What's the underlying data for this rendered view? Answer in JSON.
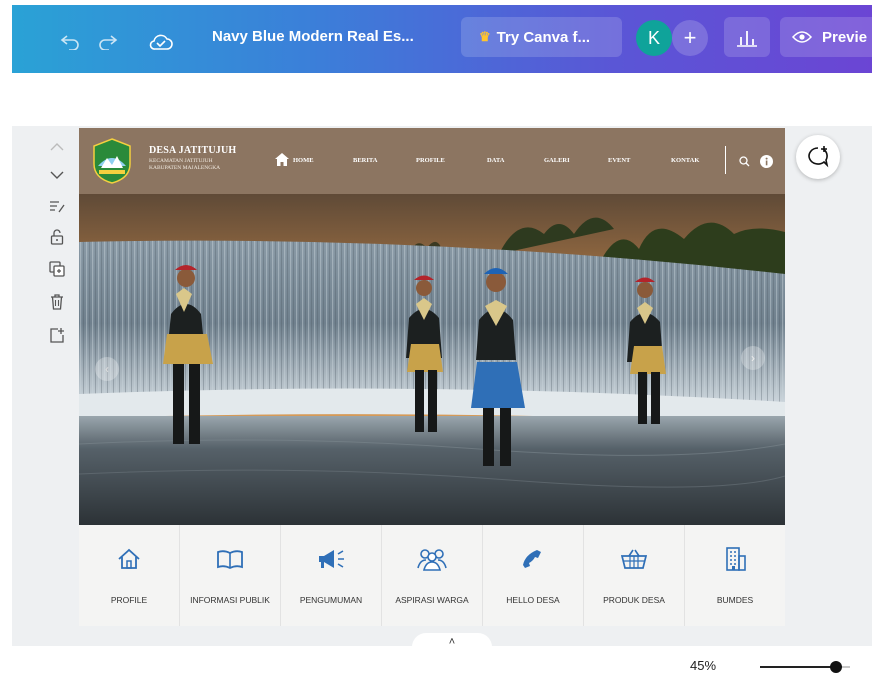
{
  "editor": {
    "doc_title": "Navy Blue Modern Real Es...",
    "try_label": "Try Canva f...",
    "avatar_initial": "K",
    "preview_label": "Previe",
    "zoom": "45%",
    "zoom_fraction": 0.45,
    "accent_start": "#2aa2d6",
    "accent_end": "#6b45d4"
  },
  "site": {
    "name": "DESA JATITUJUH",
    "subtitle": "KECAMATAN JATITUJUH KABUPATEN MAJALENGKA",
    "nav": [
      "HOME",
      "BERITA",
      "PROFILE",
      "DATA",
      "GALERI",
      "EVENT",
      "KONTAK"
    ],
    "header_color": "#8c7561"
  },
  "menu": [
    {
      "label": "PROFILE",
      "icon": "home-outline-icon"
    },
    {
      "label": "INFORMASI PUBLIK",
      "icon": "book-icon"
    },
    {
      "label": "PENGUMUMAN",
      "icon": "megaphone-icon"
    },
    {
      "label": "ASPIRASI WARGA",
      "icon": "users-icon"
    },
    {
      "label": "HELLO DESA",
      "icon": "phone-icon"
    },
    {
      "label": "PRODUK DESA",
      "icon": "basket-icon"
    },
    {
      "label": "BUMDES",
      "icon": "building-icon"
    }
  ]
}
